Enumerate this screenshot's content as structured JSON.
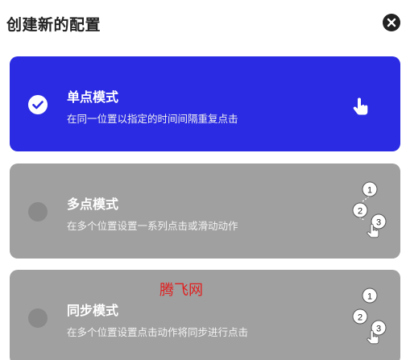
{
  "dialog": {
    "title": "创建新的配置",
    "close_icon": "close-circle-icon"
  },
  "modes": [
    {
      "title": "单点模式",
      "description": "在同一位置以指定的时间间隔重复点击",
      "selected": true,
      "icon": "single-tap-hand-icon"
    },
    {
      "title": "多点模式",
      "description": "在多个位置设置一系列点击或滑动动作",
      "selected": false,
      "icon": "multi-tap-sequence-icon",
      "step_labels": [
        "1",
        "2",
        "3"
      ]
    },
    {
      "title": "同步模式",
      "description": "在多个位置设置点击动作将同步进行点击",
      "selected": false,
      "icon": "sync-tap-sequence-icon",
      "step_labels": [
        "1",
        "2",
        "3"
      ]
    }
  ],
  "watermark": "腾飞网",
  "colors": {
    "selected_card": "#2b2be3",
    "unselected_card": "#a0a0a0",
    "radio_unselected": "#8a8a8a",
    "title_text": "#222222",
    "watermark": "#e02020"
  }
}
